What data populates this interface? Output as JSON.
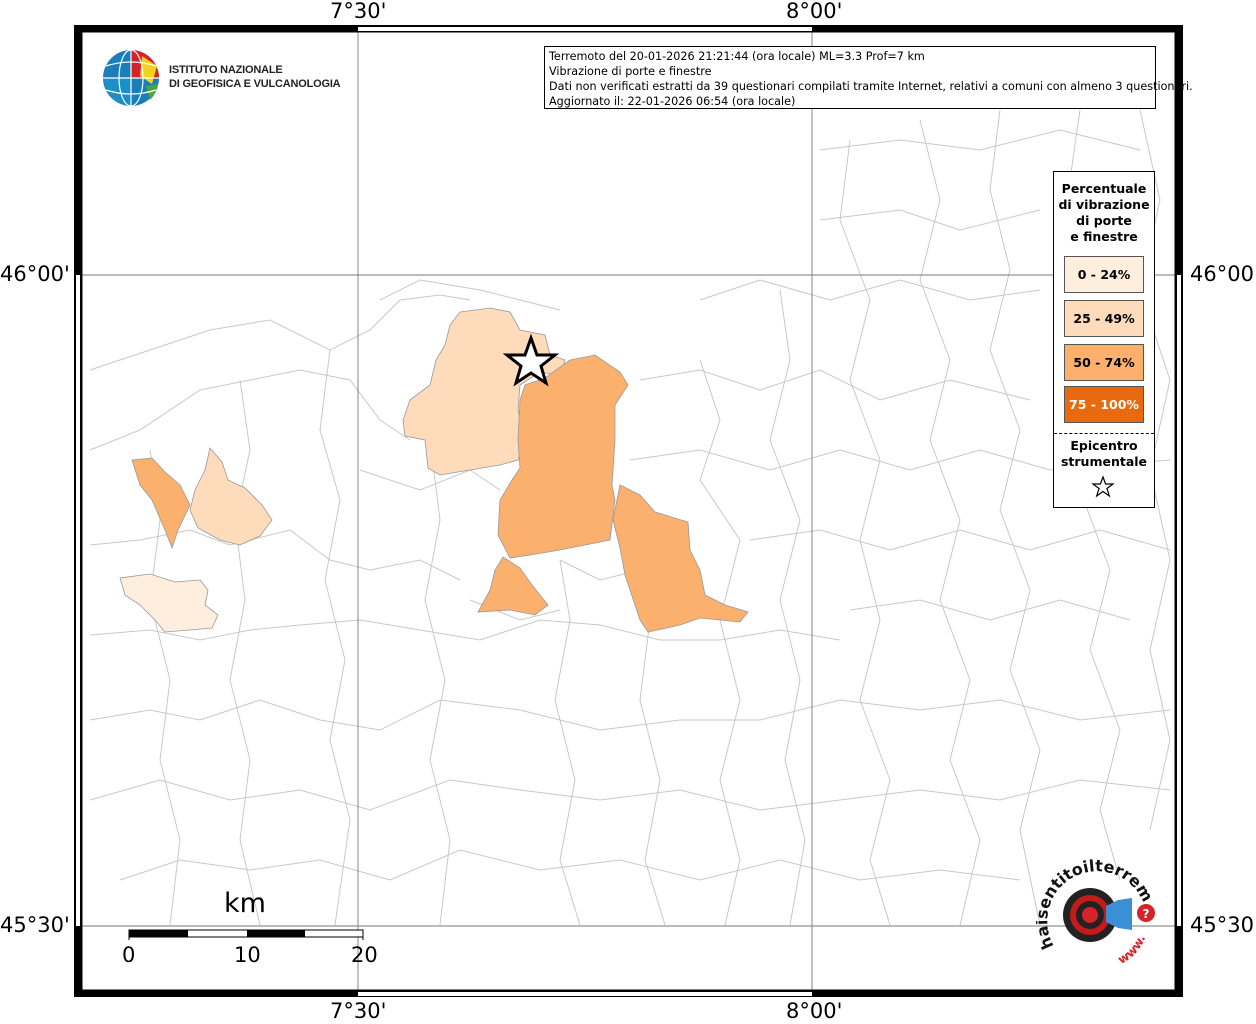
{
  "info": {
    "line1": "Terremoto del 20-01-2026 21:21:44 (ora locale) ML=3.3 Prof=7 km",
    "line2": "Vibrazione di porte e finestre",
    "line3": "Dati non verificati estratti da 39 questionari compilati tramite Internet, relativi a comuni con almeno 3 questionari.",
    "line4": "Aggiornato il: 22-01-2026 06:54 (ora locale)"
  },
  "logo": {
    "line1": "ISTITUTO NAZIONALE",
    "line2": "DI GEOFISICA E VULCANOLOGIA",
    "icon": "ingv-globe-icon"
  },
  "axes": {
    "lon_left": "7°30'",
    "lon_right": "8°00'",
    "lat_top": "46°00'",
    "lat_bottom": "45°30'"
  },
  "legend": {
    "title_lines": [
      "Percentuale",
      "di vibrazione",
      "di porte",
      "e finestre"
    ],
    "classes": [
      {
        "label": "0 - 24%",
        "color": "#fdeedd"
      },
      {
        "label": "25 - 49%",
        "color": "#fddbbb"
      },
      {
        "label": "50 - 74%",
        "color": "#fbb06e"
      },
      {
        "label": "75 - 100%",
        "color": "#e8690e"
      }
    ],
    "epicenter_lines": [
      "Epicentro",
      "strumentale"
    ],
    "epicenter_icon": "star-icon"
  },
  "scalebar": {
    "unit": "km",
    "ticks": [
      "0",
      "10",
      "20"
    ]
  },
  "badge": {
    "text": "haisentitoilterremoto.it",
    "suffix": "www.",
    "icon": "speaker-icon"
  }
}
